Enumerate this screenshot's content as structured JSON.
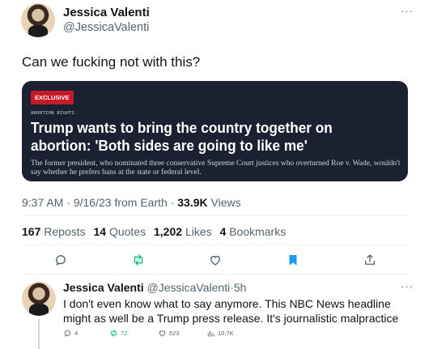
{
  "tweet": {
    "author_name": "Jessica Valenti",
    "author_handle": "@JessicaValenti",
    "more": "···",
    "text": "Can we fucking not with this?",
    "card": {
      "badge": "EXCLUSIVE",
      "kicker": "ABORTION RIGHTS",
      "headline": "Trump wants to bring the country together on abortion: 'Both sides are going to like me'",
      "dek": "The former president, who nominated three conservative Supreme Court justices who overturned Roe v. Wade, wouldn't say whether he prefers bans at the state or federal level."
    },
    "meta": {
      "time": "9:37 AM",
      "date": "9/16/23",
      "source": "from Earth",
      "views_count": "33.9K",
      "views_label": "Views"
    },
    "stats": [
      {
        "count": "167",
        "label": "Reposts"
      },
      {
        "count": "14",
        "label": "Quotes"
      },
      {
        "count": "1,202",
        "label": "Likes"
      },
      {
        "count": "4",
        "label": "Bookmarks"
      }
    ],
    "actions": [
      "reply-icon",
      "repost-icon",
      "like-icon",
      "bookmark-icon",
      "share-icon"
    ],
    "colors": {
      "repost": "#00ba7c",
      "bookmark": "#1d9bf0",
      "badge": "#c8192b",
      "card_bg": "#1b2130"
    }
  },
  "reply": {
    "author_name": "Jessica Valenti",
    "author_handle": "@JessicaValenti",
    "separator": "·",
    "age": "5h",
    "more": "···",
    "text": "I don't even know what to say anymore. This NBC News headline might as well be a Trump press release. It's journalistic malpractice",
    "actions": {
      "replies": "4",
      "reposts": "72",
      "likes": "523",
      "views": "10.7K"
    }
  }
}
